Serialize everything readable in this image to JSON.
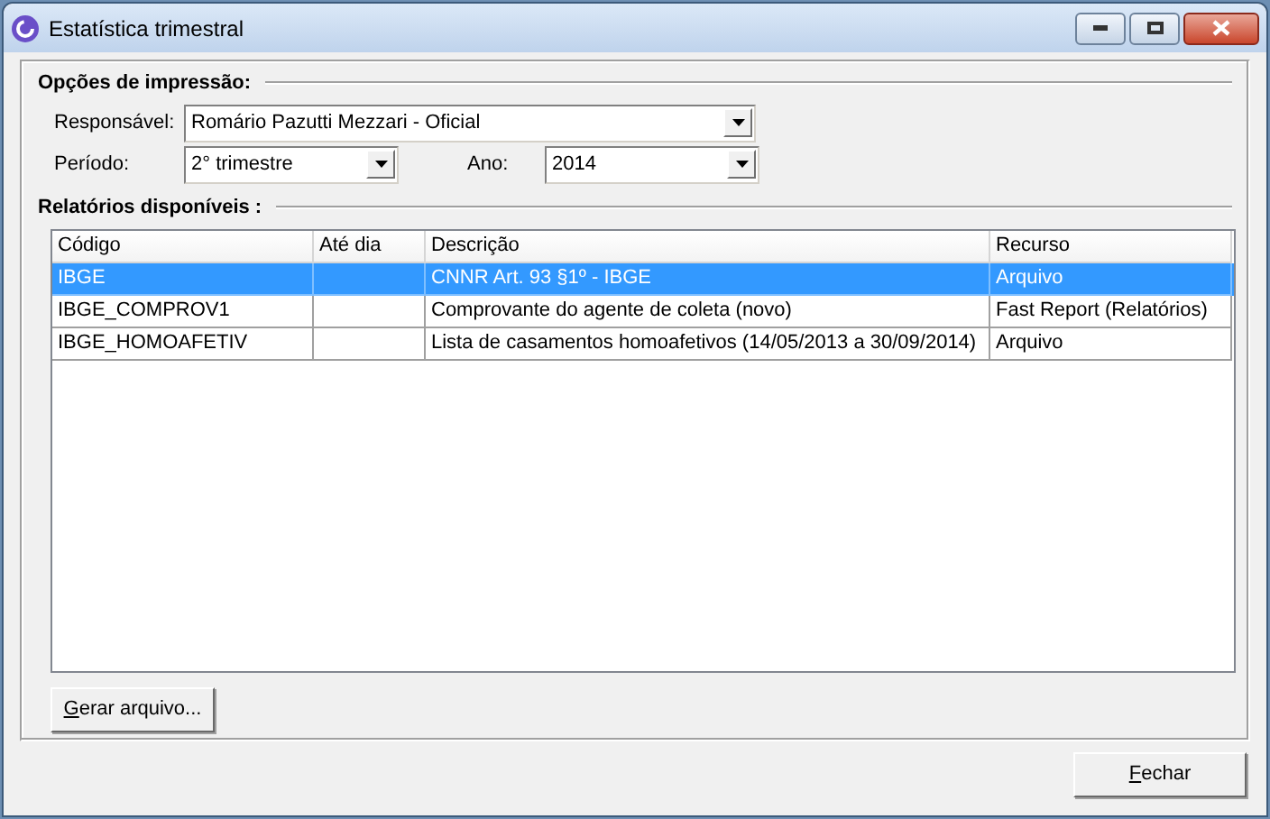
{
  "window": {
    "title": "Estatística trimestral"
  },
  "print_options": {
    "title": "Opções de impressão:",
    "fields": [
      {
        "label": "Responsável:",
        "value": "Romário Pazutti Mezzari - Oficial"
      },
      {
        "label": "Período:",
        "value": "2° trimestre"
      },
      {
        "label": "Ano:",
        "value": "2014"
      }
    ]
  },
  "reports": {
    "title": "Relatórios disponíveis :",
    "columns": [
      "Código",
      "Até dia",
      "Descrição",
      "Recurso"
    ],
    "rows": [
      {
        "cells": [
          "IBGE",
          "",
          "CNNR Art. 93 §1º - IBGE",
          "Arquivo"
        ],
        "selected": true
      },
      {
        "cells": [
          "IBGE_COMPROV1",
          "",
          "Comprovante do agente de coleta (novo)",
          "Fast Report (Relatórios)"
        ],
        "selected": false
      },
      {
        "cells": [
          "IBGE_HOMOAFETIV",
          "",
          "Lista de casamentos homoafetivos (14/05/2013 a 30/09/2014)",
          "Arquivo"
        ],
        "selected": false
      }
    ]
  },
  "generate_button": {
    "label": "Gerar arquivo..."
  },
  "close_button": {
    "label": "Fechar"
  }
}
